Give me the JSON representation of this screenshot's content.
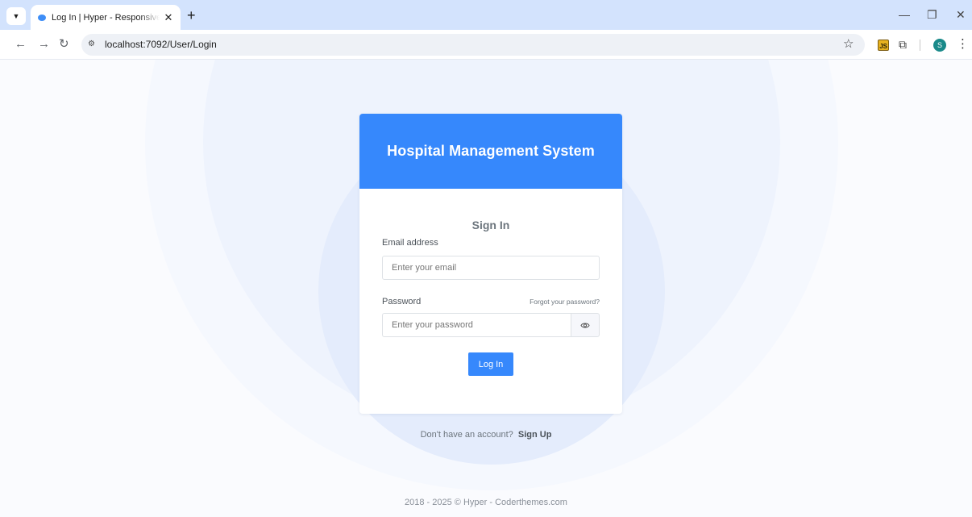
{
  "browser": {
    "tab_title": "Log In | Hyper - Responsive Bootstrap",
    "tab_close": "✕",
    "new_tab": "+",
    "url": "localhost:7092/User/Login",
    "avatar_letter": "S",
    "ext_js_label": "JS"
  },
  "auth": {
    "header_title": "Hospital Management System",
    "sign_in_title": "Sign In",
    "email_label": "Email address",
    "email_placeholder": "Enter your email",
    "email_value": "",
    "password_label": "Password",
    "forgot_link": "Forgot your password?",
    "password_placeholder": "Enter your password",
    "password_value": "",
    "login_button": "Log In"
  },
  "signup": {
    "prompt": "Don't have an account?",
    "link": "Sign Up"
  },
  "footer": {
    "text": "2018 - 2025 © Hyper - Coderthemes.com"
  },
  "colors": {
    "primary": "#3688fc",
    "tabstrip": "#d3e3fd",
    "page_bg": "#fafbfe"
  }
}
